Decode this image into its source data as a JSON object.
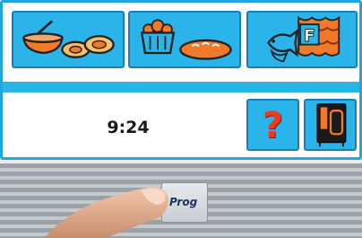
{
  "screen": {
    "categories": [
      {
        "id": "meals",
        "icon": "meals-dishes-icon"
      },
      {
        "id": "bakery",
        "icon": "bread-basket-icon"
      },
      {
        "id": "fish-vegetables",
        "icon": "fish-food-icon",
        "badge": "F"
      }
    ],
    "clock": {
      "time": "9:24"
    },
    "help": {
      "glyph": "?",
      "icon": "help-icon"
    },
    "oven": {
      "icon": "oven-icon"
    }
  },
  "control_panel": {
    "prog_key": {
      "label": "Prog"
    }
  },
  "colors": {
    "accent": "#2ab4ea",
    "border": "#1ea6e0",
    "icon_orange": "#f07a2c",
    "help_red": "#ef3a1c"
  }
}
